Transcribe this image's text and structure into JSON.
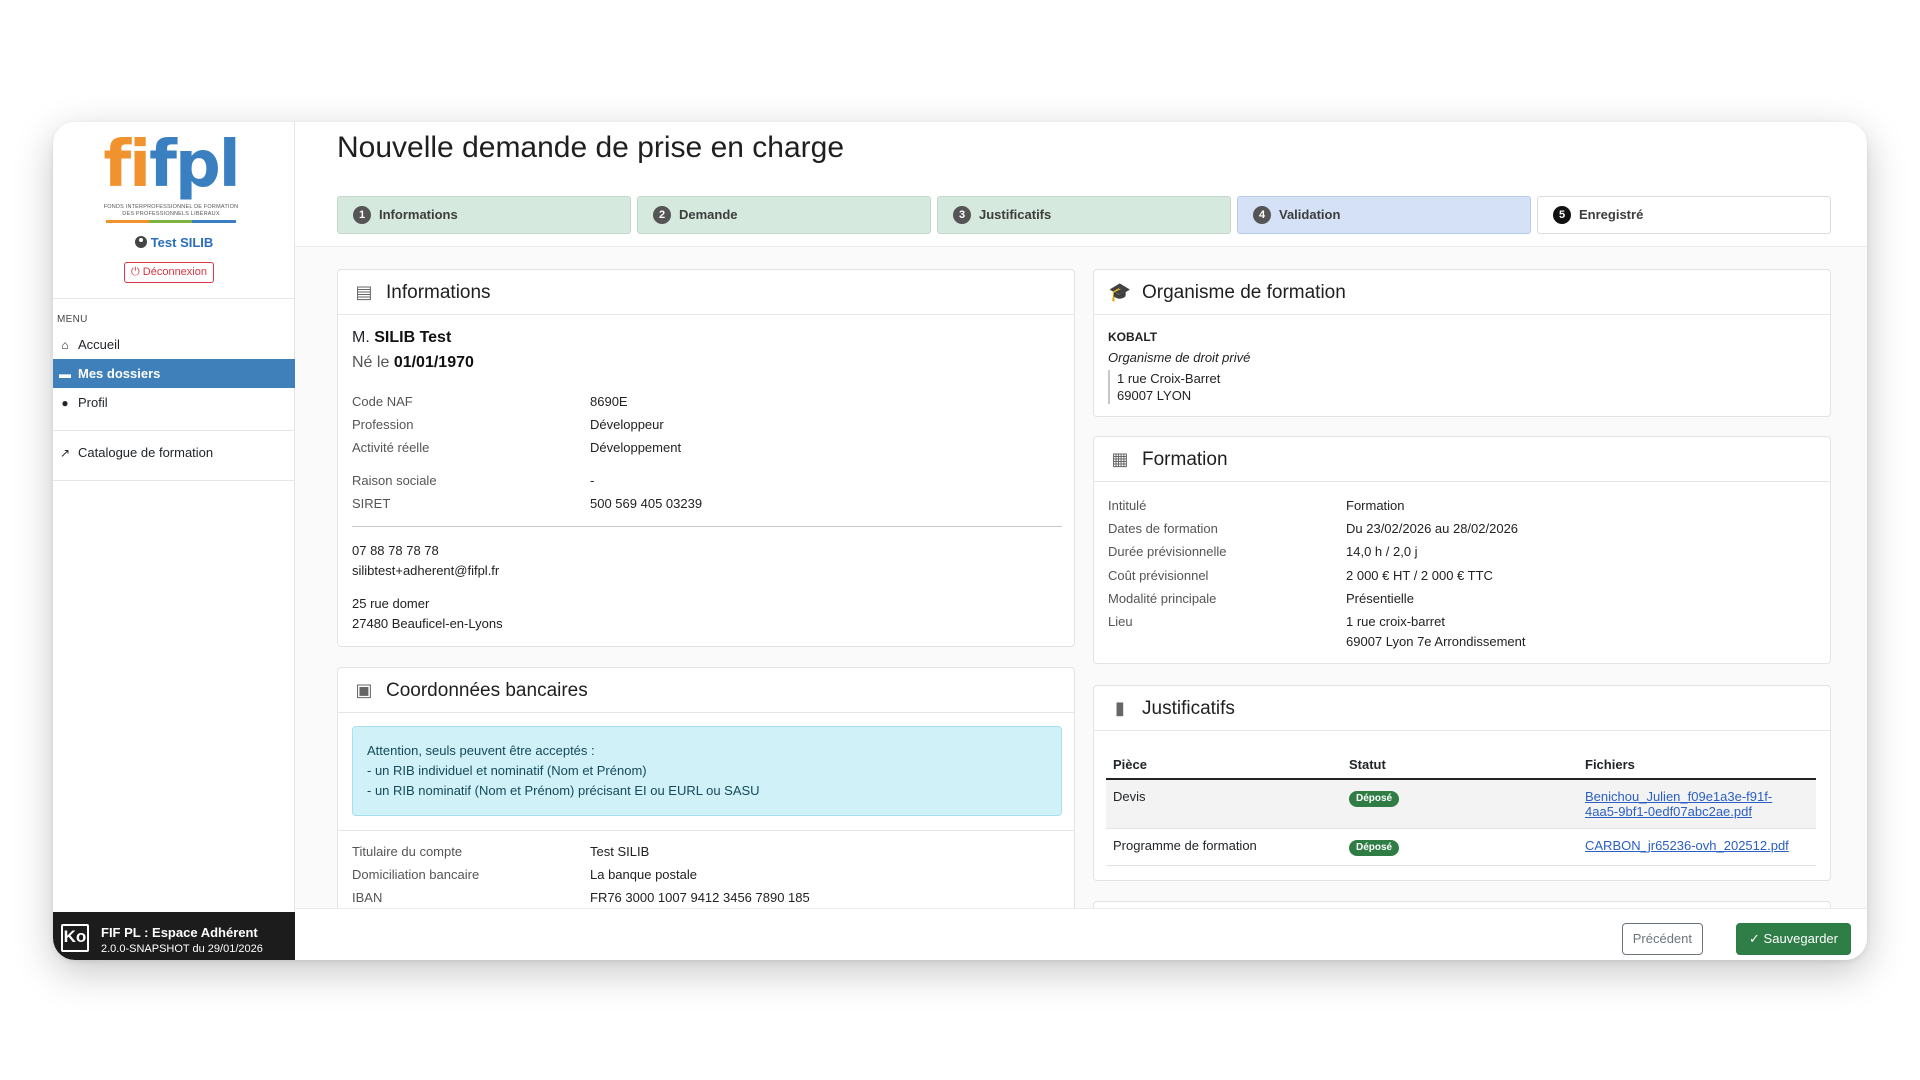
{
  "sidebar": {
    "logo_text_fi": "fi",
    "logo_text_fpl": "fpl",
    "logo_tagline_1": "FONDS INTERPROFESSIONNEL DE FORMATION",
    "logo_tagline_2": "DES PROFESSIONNELS LIBÉRAUX",
    "user_name": "Test SILIB",
    "logout_label": "Déconnexion",
    "menu_label": "MENU",
    "items": [
      {
        "label": "Accueil",
        "icon": "home-icon"
      },
      {
        "label": "Mes dossiers",
        "icon": "folder-open-icon",
        "active": true
      },
      {
        "label": "Profil",
        "icon": "user-icon"
      }
    ],
    "catalog_label": "Catalogue de formation",
    "footer": {
      "badge": "Ko",
      "app_name": "FIF PL : Espace Adhérent",
      "version": "2.0.0-SNAPSHOT du 29/01/2026"
    }
  },
  "header": {
    "title": "Nouvelle demande de prise en charge",
    "steps": [
      {
        "num": "1",
        "label": "Informations",
        "state": "done"
      },
      {
        "num": "2",
        "label": "Demande",
        "state": "done"
      },
      {
        "num": "3",
        "label": "Justificatifs",
        "state": "done"
      },
      {
        "num": "4",
        "label": "Validation",
        "state": "current"
      },
      {
        "num": "5",
        "label": "Enregistré",
        "state": "pending"
      }
    ]
  },
  "informations": {
    "title": "Informations",
    "civility": "M.",
    "name": "SILIB Test",
    "born_prefix": "Né le",
    "birthdate": "01/01/1970",
    "fields": [
      {
        "label": "Code NAF",
        "value": "8690E"
      },
      {
        "label": "Profession",
        "value": "Développeur"
      },
      {
        "label": "Activité réelle",
        "value": "Développement"
      },
      {
        "label": "Raison sociale",
        "value": "-"
      },
      {
        "label": "SIRET",
        "value": "500 569 405 03239"
      }
    ],
    "phone": "07 88 78 78 78",
    "email": "silibtest+adherent@fifpl.fr",
    "address_line1": "25 rue domer",
    "address_line2": "27480 Beauficel-en-Lyons"
  },
  "bank": {
    "title": "Coordonnées bancaires",
    "alert_lines": [
      "Attention, seuls peuvent être acceptés :",
      "- un RIB individuel et nominatif (Nom et Prénom)",
      "- un RIB nominatif (Nom et Prénom) précisant EI ou EURL ou SASU"
    ],
    "fields": [
      {
        "label": "Titulaire du compte",
        "value": "Test SILIB"
      },
      {
        "label": "Domiciliation bancaire",
        "value": "La banque postale"
      },
      {
        "label": "IBAN",
        "value": "FR76 3000 1007 9412 3456 7890 185"
      }
    ]
  },
  "organisme": {
    "title": "Organisme de formation",
    "name": "KOBALT",
    "type": "Organisme de droit privé",
    "address_line1": "1 rue Croix-Barret",
    "address_line2": "69007 LYON"
  },
  "formation": {
    "title": "Formation",
    "fields": [
      {
        "label": "Intitulé",
        "value": "Formation"
      },
      {
        "label": "Dates de formation",
        "value": "Du 23/02/2026 au 28/02/2026"
      },
      {
        "label": "Durée prévisionnelle",
        "value": "14,0 h / 2,0 j"
      },
      {
        "label": "Coût prévisionnel",
        "value": "2 000 € HT / 2 000 € TTC"
      },
      {
        "label": "Modalité principale",
        "value": "Présentielle"
      },
      {
        "label": "Lieu",
        "value": "1 rue croix-barret"
      }
    ],
    "lieu_line2": "69007 Lyon 7e Arrondissement"
  },
  "justificatifs": {
    "title": "Justificatifs",
    "columns": [
      "Pièce",
      "Statut",
      "Fichiers"
    ],
    "rows": [
      {
        "piece": "Devis",
        "status": "Déposé",
        "file_line1": "Benichou_Julien_f09e1a3e-f91f-",
        "file_line2": "4aa5-9bf1-0edf07abc2ae.pdf"
      },
      {
        "piece": "Programme de formation",
        "status": "Déposé",
        "file_line1": "CARBON_jr65236-ovh_202512.pdf",
        "file_line2": ""
      }
    ]
  },
  "footer": {
    "prev_label": "Précédent",
    "save_label": "Sauvegarder"
  }
}
